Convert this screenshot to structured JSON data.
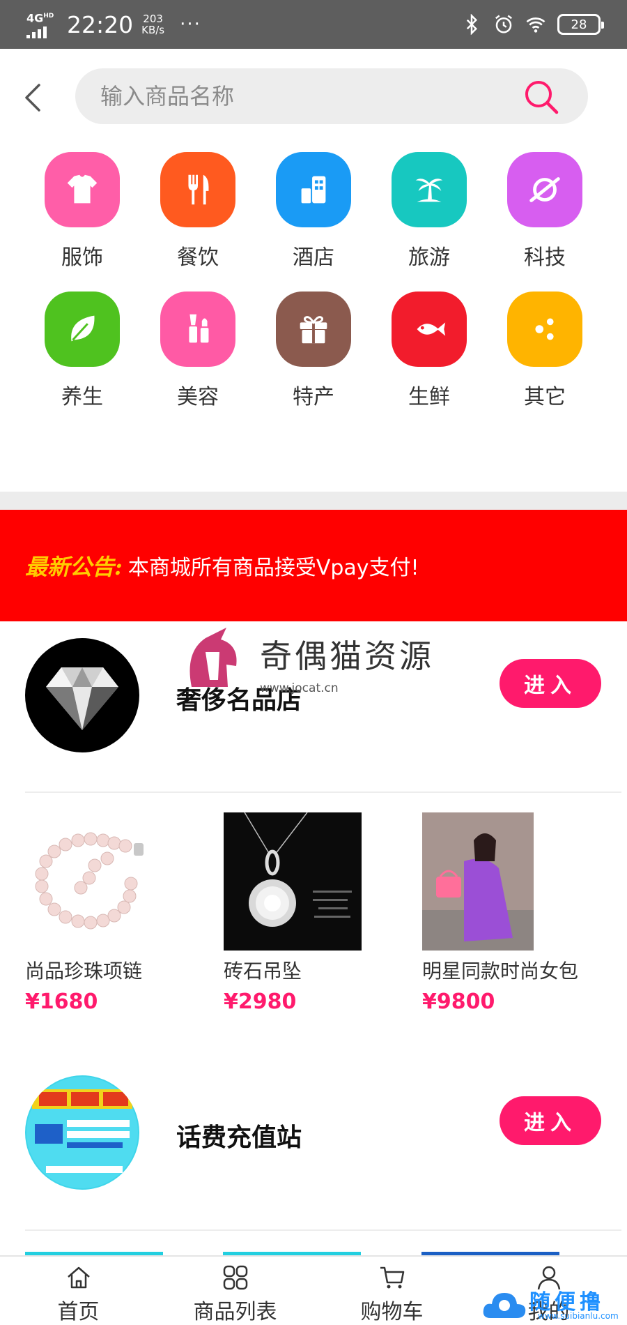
{
  "status_bar": {
    "network": "4G",
    "network_sup": "HD",
    "time": "22:20",
    "speed_value": "203",
    "speed_unit": "KB/s",
    "more": "···",
    "battery": "28"
  },
  "search": {
    "placeholder": "输入商品名称"
  },
  "categories": [
    {
      "label": "服饰",
      "icon": "tshirt-icon",
      "color": "#ff5ea8"
    },
    {
      "label": "餐饮",
      "icon": "fork-knife-icon",
      "color": "#ff5a1f"
    },
    {
      "label": "酒店",
      "icon": "hotel-icon",
      "color": "#1a9bf5"
    },
    {
      "label": "旅游",
      "icon": "palm-tree-icon",
      "color": "#17c8c0"
    },
    {
      "label": "科技",
      "icon": "planet-icon",
      "color": "#d75ef0"
    },
    {
      "label": "养生",
      "icon": "leaf-icon",
      "color": "#4fc21f"
    },
    {
      "label": "美容",
      "icon": "cosmetics-icon",
      "color": "#ff5aa5"
    },
    {
      "label": "特产",
      "icon": "gift-icon",
      "color": "#8b5a4e"
    },
    {
      "label": "生鲜",
      "icon": "fish-icon",
      "color": "#f21c2c"
    },
    {
      "label": "其它",
      "icon": "dots-icon",
      "color": "#ffb400"
    }
  ],
  "notice": {
    "title": "最新公告:",
    "text": "本商城所有商品接受Vpay支付!"
  },
  "watermark": {
    "text": "奇偶猫资源",
    "url": "www.jocat.cn"
  },
  "stores": [
    {
      "name": "奢侈名品店",
      "enter_label": "进入",
      "logo": "diamond-logo"
    },
    {
      "name": "话费充值站",
      "enter_label": "进入",
      "logo": "recharge-logo"
    }
  ],
  "products": [
    {
      "name": "尚品珍珠项链",
      "price": "¥1680",
      "image": "pearl-necklace"
    },
    {
      "name": "砖石吊坠",
      "price": "¥2980",
      "image": "diamond-pendant"
    },
    {
      "name": "明星同款时尚女包",
      "price": "¥9800",
      "image": "fashion-handbag"
    }
  ],
  "tabbar": [
    {
      "label": "首页",
      "icon": "home-icon"
    },
    {
      "label": "商品列表",
      "icon": "grid-icon"
    },
    {
      "label": "购物车",
      "icon": "cart-icon"
    },
    {
      "label": "我的",
      "icon": "user-icon"
    }
  ],
  "corner_watermark": {
    "text": "随便撸",
    "url": "www.suibianlu.com"
  },
  "colors": {
    "accent": "#ff1a6c",
    "notice_bg": "#ff0000",
    "notice_title": "#ffcc00",
    "status_bar": "#5e5e5e"
  }
}
